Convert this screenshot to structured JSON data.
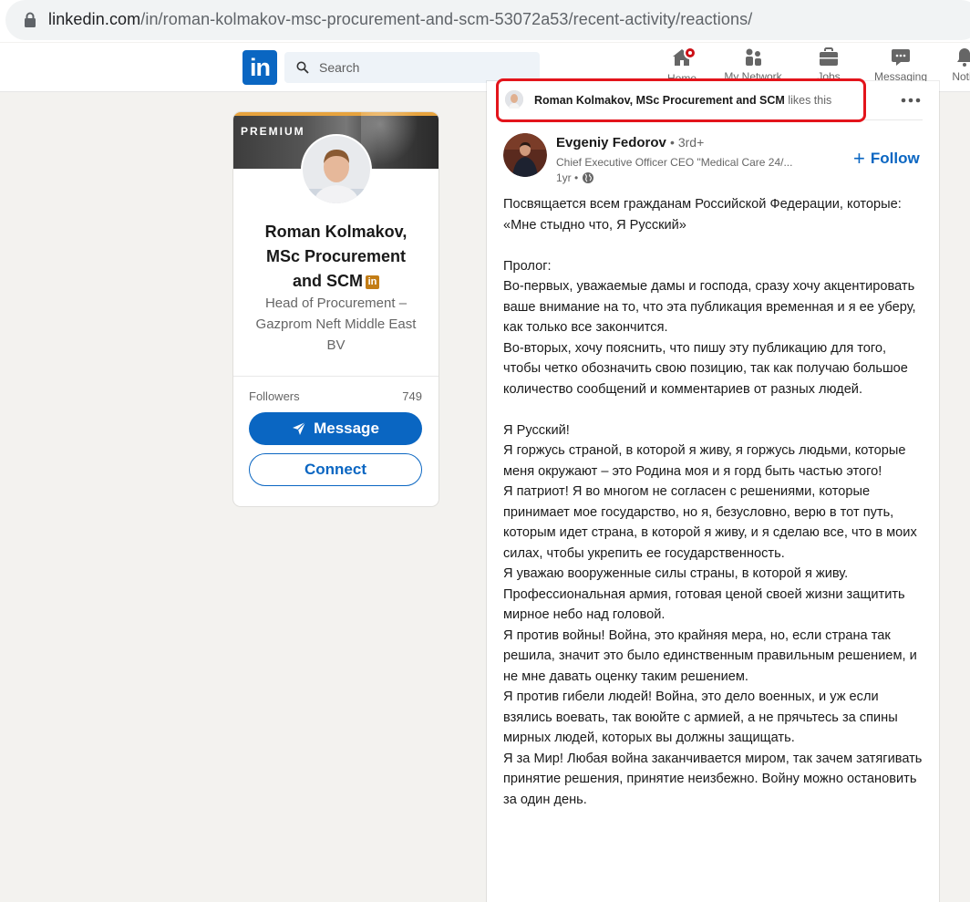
{
  "browser": {
    "url_host": "linkedin.com",
    "url_path": "/in/roman-kolmakov-msc-procurement-and-scm-53072a53/recent-activity/reactions/"
  },
  "nav": {
    "logo": "in",
    "search_placeholder": "Search",
    "items": [
      {
        "label": "Home"
      },
      {
        "label": "My Network"
      },
      {
        "label": "Jobs"
      },
      {
        "label": "Messaging"
      },
      {
        "label": "Notifi"
      }
    ]
  },
  "profile": {
    "premium_label": "PREMIUM",
    "name": "Roman Kolmakov, MSc Procurement and SCM",
    "badge": "in",
    "headline": "Head of Procurement – Gazprom Neft Middle East BV",
    "followers_label": "Followers",
    "followers_count": "749",
    "message_label": "Message",
    "connect_label": "Connect"
  },
  "post": {
    "activity_actor": "Roman Kolmakov, MSc Procurement and SCM",
    "activity_suffix": "likes this",
    "author_name": "Evgeniy Fedorov",
    "author_degree": "• 3rd+",
    "author_title": "Chief Executive Officer CEO \"Medical Care 24/...",
    "time": "1yr •",
    "follow_label": "Follow",
    "paragraphs": [
      "Посвящается всем гражданам Российской Федерации, которые:",
      "«Мне стыдно что, Я Русский»",
      "",
      "Пролог:",
      "Во-первых, уважаемые дамы и господа, сразу хочу акцентировать ваше внимание на то, что эта публикация временная и я ее уберу, как только все закончится.",
      "Во-вторых, хочу пояснить, что пишу эту публикацию для того, чтобы четко обозначить свою позицию, так как получаю большое количество сообщений и комментариев от разных людей.",
      "",
      "Я Русский!",
      "Я горжусь страной, в которой я живу, я горжусь людьми, которые меня окружают – это Родина моя и я горд быть частью этого!",
      "Я патриот! Я во многом не согласен с решениями, которые принимает мое государство, но я, безусловно, верю в тот путь, которым идет страна, в которой я живу, и я сделаю все, что в моих силах, чтобы укрепить ее государственность.",
      "Я уважаю вооруженные силы страны, в которой я живу. Профессиональная армия, готовая ценой своей жизни защитить мирное небо над головой.",
      "Я против войны! Война, это крайняя мера, но, если страна так решила, значит это было единственным правильным решением, и не мне давать оценку таким решением.",
      "Я против гибели людей! Война, это дело военных, и уж если взялись воевать, так воюйте с армией, а не прячьтесь за спины мирных людей, которых вы должны защищать.",
      "Я за Мир! Любая война заканчивается миром, так зачем затягивать принятие решения, принятие неизбежно. Войну можно остановить за один день."
    ]
  },
  "colors": {
    "linkedin_blue": "#0a66c2",
    "highlight_red": "#e3141b",
    "premium_gold": "#c37d16",
    "notification_red": "#cc1016"
  }
}
